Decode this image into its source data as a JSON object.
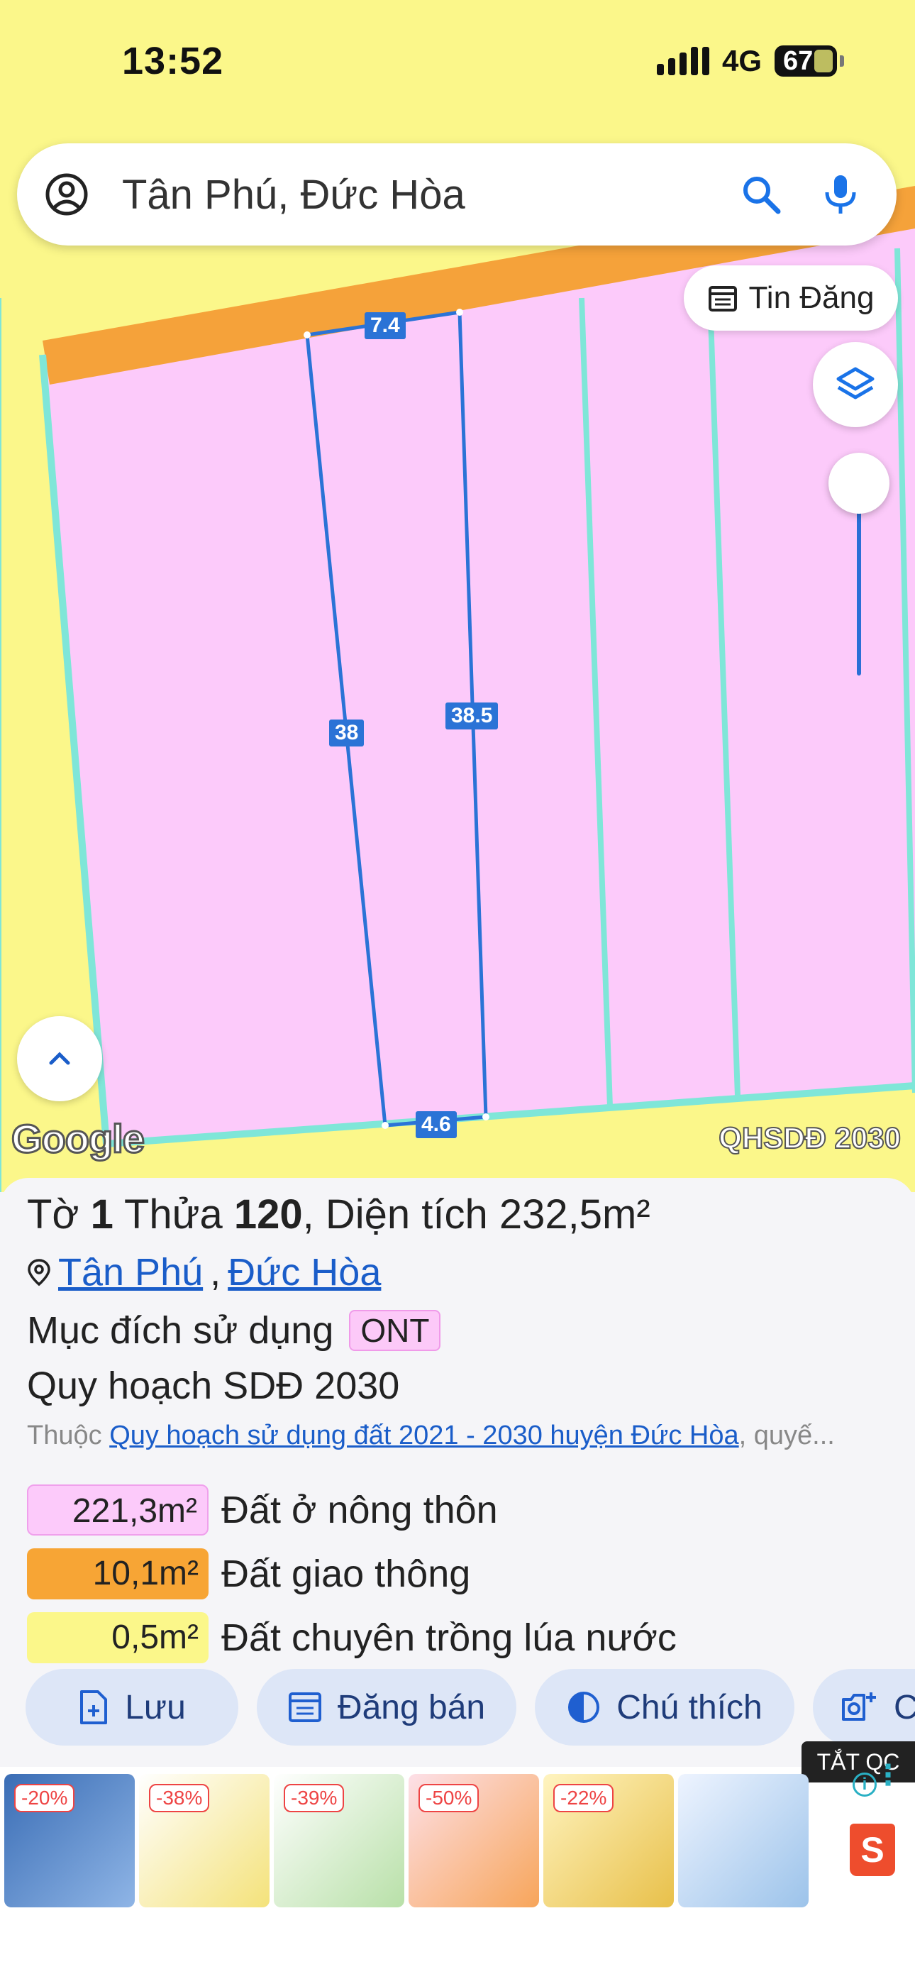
{
  "status": {
    "time": "13:52",
    "network": "4G",
    "battery": "67"
  },
  "search": {
    "query": "Tân Phú, Đức Hòa"
  },
  "map": {
    "chip_label": "Tin Đăng",
    "layer_label": "QHSDĐ 2030",
    "logo": "Google",
    "dimensions": {
      "top": "7.4",
      "left": "38",
      "right": "38.5",
      "bottom": "4.6"
    },
    "colors": {
      "rural_land": "#fccafa",
      "road": "#f5a23a",
      "rice": "#fbf78a",
      "boundary": "#2b73d6"
    }
  },
  "parcel": {
    "sheet_label": "Tờ",
    "sheet": "1",
    "plot_label": "Thửa",
    "plot": "120",
    "area_label": "Diện tích",
    "area": "232,5m²",
    "commune": "Tân Phú",
    "district": "Đức Hòa",
    "purpose_label": "Mục đích sử dụng",
    "purpose_code": "ONT",
    "plan_label": "Quy hoạch SDĐ 2030",
    "source_prefix": "Thuộc",
    "source_link": "Quy hoạch sử dụng đất 2021 - 2030 huyện Đức Hòa",
    "source_suffix": ", quyế..."
  },
  "land_uses": [
    {
      "area": "221,3m²",
      "name": "Đất ở nông thôn",
      "color": "#fccafa"
    },
    {
      "area": "10,1m²",
      "name": "Đất giao thông",
      "color": "#f7a535"
    },
    {
      "area": "0,5m²",
      "name": "Đất chuyên trồng lúa nước",
      "color": "#fbf78a"
    }
  ],
  "actions": [
    {
      "label": "Lưu",
      "icon": "file-add-icon"
    },
    {
      "label": "Đăng bán",
      "icon": "calendar-list-icon"
    },
    {
      "label": "Chú thích",
      "icon": "contrast-icon"
    },
    {
      "label": "C",
      "icon": "camera-add-icon"
    }
  ],
  "ads": {
    "close_label": "TẮT QC",
    "items": [
      {
        "discount": "-20%"
      },
      {
        "discount": "-38%"
      },
      {
        "discount": "-39%"
      },
      {
        "discount": "-50%"
      },
      {
        "discount": "-22%"
      },
      {
        "discount": ""
      }
    ],
    "shopee": "S"
  }
}
